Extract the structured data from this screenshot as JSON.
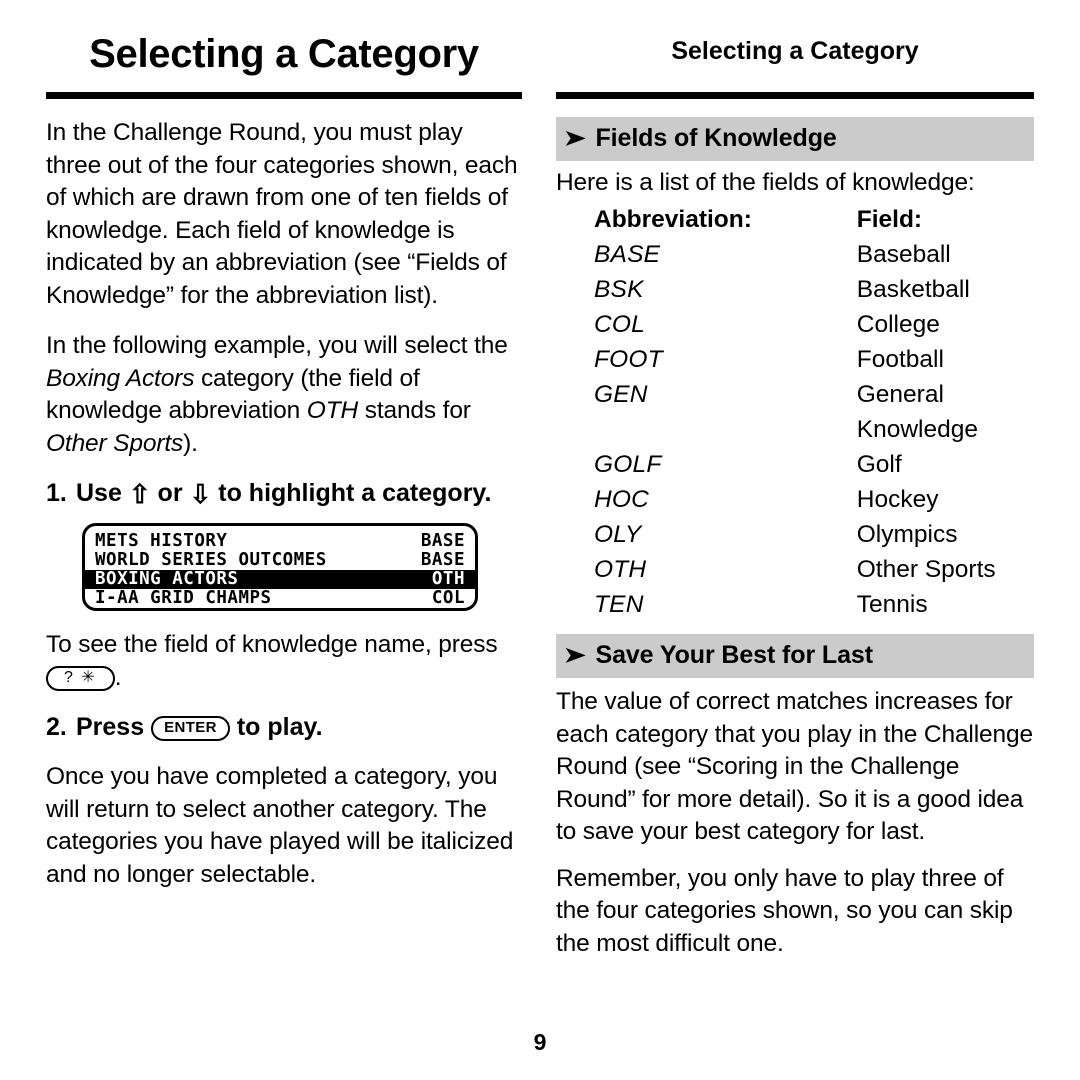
{
  "page": {
    "number": "9",
    "left_title": "Selecting a Category",
    "right_title": "Selecting a Category"
  },
  "left_column": {
    "paragraph_1": "In the Challenge Round, you must play three out of the four categories shown, each of which are drawn from one of ten fields of knowledge. Each field of knowledge is indicated by an abbreviation (see “Fields of Knowledge” for the abbreviation list).",
    "paragraph_2_part1": "In the following example, you will select the ",
    "paragraph_2_italic1": "Boxing Actors",
    "paragraph_2_part2": " category (the field of knowledge abbreviation ",
    "paragraph_2_italic2": "OTH",
    "paragraph_2_part3": " stands for ",
    "paragraph_2_italic3": "Other Sports",
    "paragraph_2_part4": ").",
    "step1": {
      "number": "1.",
      "text_part1": "Use ",
      "up_arrow": "⇧",
      "text_part2": " or ",
      "down_arrow": "⇩",
      "text_part3": " to highlight a category."
    },
    "lcd": {
      "rows": [
        {
          "name": "METS HISTORY",
          "abbr": "BASE",
          "selected": false
        },
        {
          "name": "WORLD SERIES OUTCOMES",
          "abbr": "BASE",
          "selected": false
        },
        {
          "name": "BOXING ACTORS",
          "abbr": "OTH",
          "selected": true
        },
        {
          "name": "I-AA GRID CHAMPS",
          "abbr": "COL",
          "selected": false
        }
      ]
    },
    "lcd_caption_part1": "To see the field of knowledge name, press ",
    "lcd_caption_key": "? ✳",
    "lcd_caption_part2": ".",
    "step2": {
      "number": "2.",
      "text_part1": "Press ",
      "key": "ENTER",
      "text_part2": " to play."
    },
    "step2_body": "Once you have completed a category, you will return to select another category. The categories you have played will be italicized and no longer selectable."
  },
  "right_column": {
    "section1": {
      "bullet": "➤",
      "heading": "Fields of Knowledge",
      "intro": "Here is a list of the fields of knowledge:",
      "table": {
        "header_abbreviation": "Abbreviation:",
        "header_field": "Field:",
        "rows": [
          {
            "abbr": "BASE",
            "field": "Baseball"
          },
          {
            "abbr": "BSK",
            "field": "Basketball"
          },
          {
            "abbr": "COL",
            "field": "College"
          },
          {
            "abbr": "FOOT",
            "field": "Football"
          },
          {
            "abbr": "GEN",
            "field": "General Knowledge"
          },
          {
            "abbr": "GOLF",
            "field": "Golf"
          },
          {
            "abbr": "HOC",
            "field": "Hockey"
          },
          {
            "abbr": "OLY",
            "field": "Olympics"
          },
          {
            "abbr": "OTH",
            "field": "Other Sports"
          },
          {
            "abbr": "TEN",
            "field": "Tennis"
          }
        ]
      }
    },
    "section2": {
      "bullet": "➤",
      "heading": "Save Your Best for Last",
      "paragraph_1": "The value of correct matches increases for each category that you play in the Challenge Round (see “Scoring in the Challenge Round” for more detail). So it is a good idea to save your best category for last.",
      "paragraph_2": "Remember, you only have to play three of the four categories shown, so you can skip the most difficult one."
    }
  }
}
